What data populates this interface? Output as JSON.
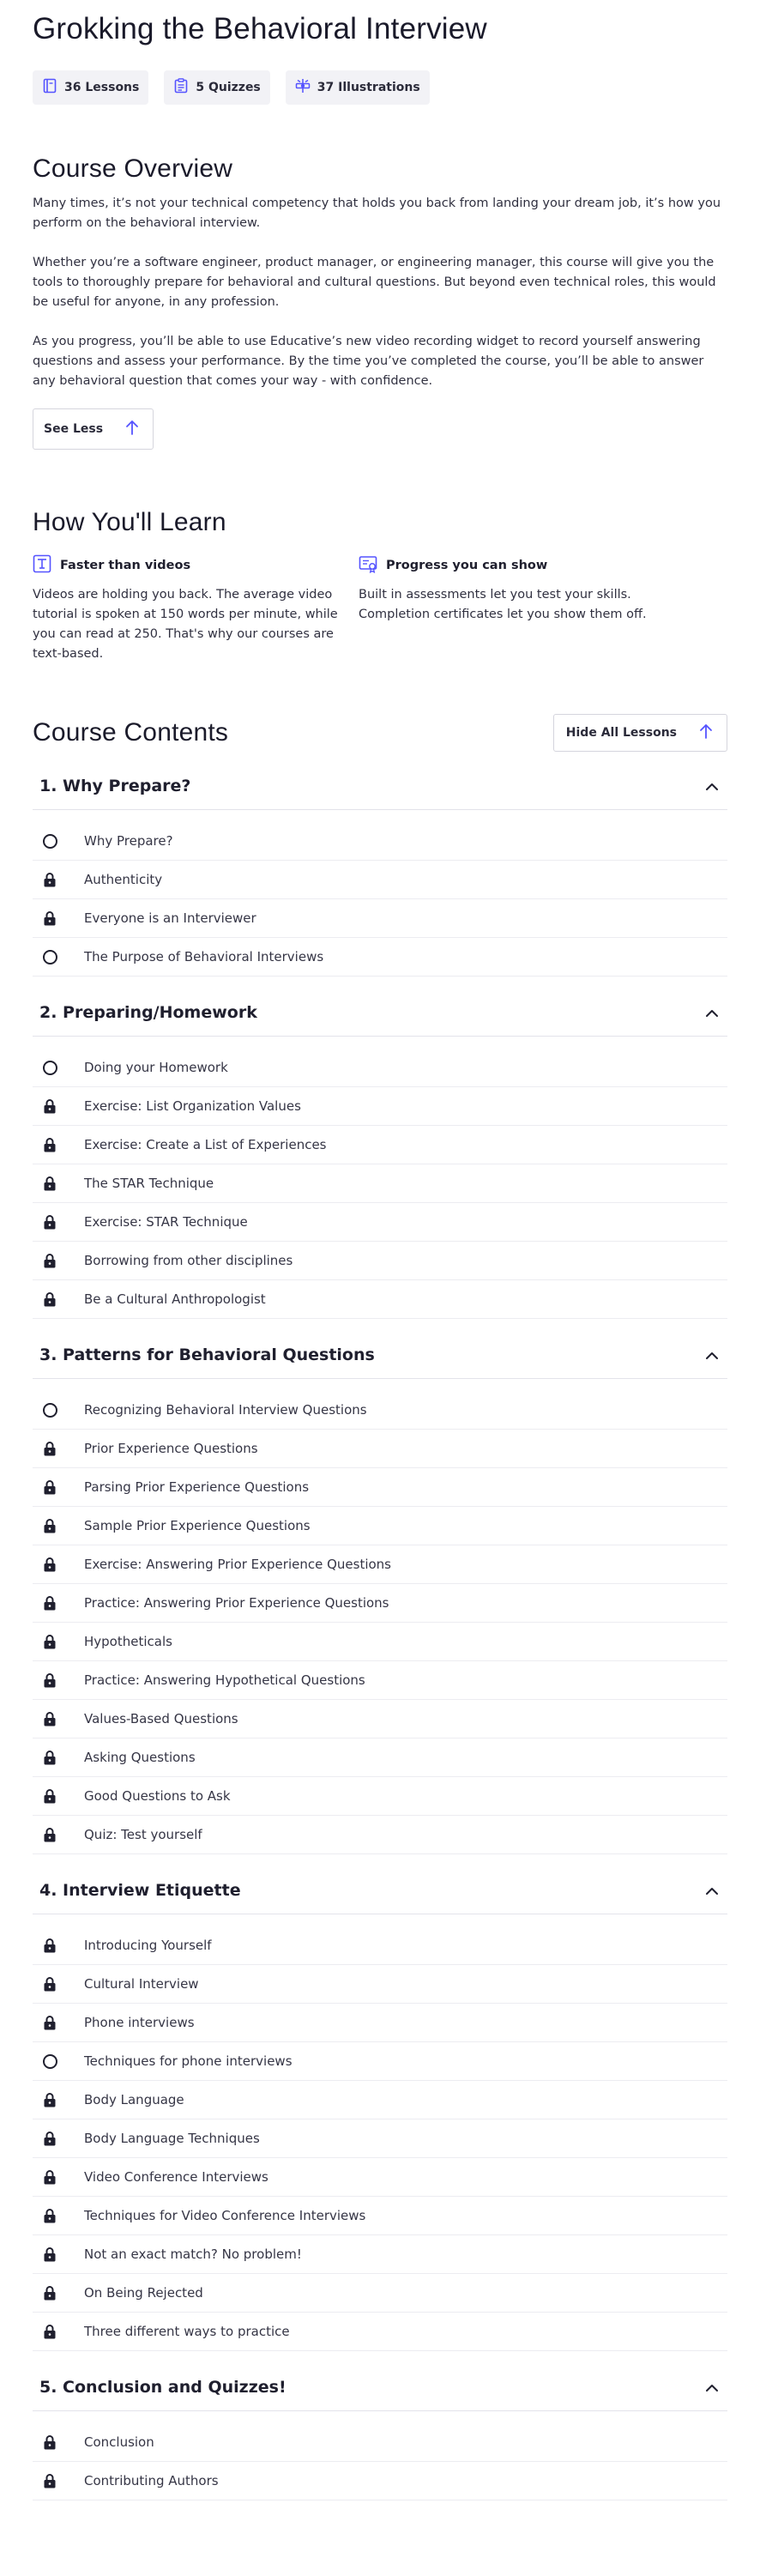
{
  "course": {
    "title": "Grokking the Behavioral Interview",
    "stats": [
      {
        "label": "36 Lessons",
        "icon": "lessons-icon"
      },
      {
        "label": "5 Quizzes",
        "icon": "quiz-icon"
      },
      {
        "label": "37 Illustrations",
        "icon": "illustrations-icon"
      }
    ]
  },
  "overview": {
    "heading": "Course Overview",
    "paragraphs": [
      "Many times, it’s not your technical competency that holds you back from landing your dream job, it’s how you perform on the behavioral interview.",
      "Whether you’re a software engineer, product manager, or engineering manager, this course will give you the tools to thoroughly prepare for behavioral and cultural questions. But beyond even technical roles, this would be useful for anyone, in any profession.",
      "As you progress, you’ll be able to use Educative’s new video recording widget to record yourself answering questions and assess your performance. By the time you’ve completed the course, you’ll be able to answer any behavioral question that comes your way - with confidence."
    ],
    "see_less": "See Less"
  },
  "learn": {
    "heading": "How You'll Learn",
    "items": [
      {
        "title": "Faster than videos",
        "text": "Videos are holding you back. The average video tutorial is spoken at 150 words per minute, while you can read at 250. That's why our courses are text-based."
      },
      {
        "title": "Progress you can show",
        "text": "Built in assessments let you test your skills. Completion certificates let you show them off."
      }
    ]
  },
  "contents": {
    "heading": "Course Contents",
    "hide_all": "Hide All Lessons",
    "sections": [
      {
        "title": "1. Why Prepare?",
        "lessons": [
          {
            "name": "Why Prepare?",
            "status": "open"
          },
          {
            "name": "Authenticity",
            "status": "locked"
          },
          {
            "name": "Everyone is an Interviewer",
            "status": "locked"
          },
          {
            "name": "The Purpose of Behavioral Interviews",
            "status": "open"
          }
        ]
      },
      {
        "title": "2. Preparing/Homework",
        "lessons": [
          {
            "name": "Doing your Homework",
            "status": "open"
          },
          {
            "name": "Exercise: List Organization Values",
            "status": "locked"
          },
          {
            "name": "Exercise: Create a List of Experiences",
            "status": "locked"
          },
          {
            "name": "The STAR Technique",
            "status": "locked"
          },
          {
            "name": "Exercise: STAR Technique",
            "status": "locked"
          },
          {
            "name": "Borrowing from other disciplines",
            "status": "locked"
          },
          {
            "name": "Be a Cultural Anthropologist",
            "status": "locked"
          }
        ]
      },
      {
        "title": "3. Patterns for Behavioral Questions",
        "lessons": [
          {
            "name": "Recognizing Behavioral Interview Questions",
            "status": "open"
          },
          {
            "name": "Prior Experience Questions",
            "status": "locked"
          },
          {
            "name": "Parsing Prior Experience Questions",
            "status": "locked"
          },
          {
            "name": "Sample Prior Experience Questions",
            "status": "locked"
          },
          {
            "name": "Exercise: Answering Prior Experience Questions",
            "status": "locked"
          },
          {
            "name": "Practice: Answering Prior Experience Questions",
            "status": "locked"
          },
          {
            "name": "Hypotheticals",
            "status": "locked"
          },
          {
            "name": "Practice: Answering Hypothetical Questions",
            "status": "locked"
          },
          {
            "name": "Values-Based Questions",
            "status": "locked"
          },
          {
            "name": "Asking Questions",
            "status": "locked"
          },
          {
            "name": "Good Questions to Ask",
            "status": "locked"
          },
          {
            "name": "Quiz: Test yourself",
            "status": "locked"
          }
        ]
      },
      {
        "title": "4. Interview Etiquette",
        "lessons": [
          {
            "name": "Introducing Yourself",
            "status": "locked"
          },
          {
            "name": "Cultural Interview",
            "status": "locked"
          },
          {
            "name": "Phone interviews",
            "status": "locked"
          },
          {
            "name": "Techniques for phone interviews",
            "status": "open"
          },
          {
            "name": "Body Language",
            "status": "locked"
          },
          {
            "name": "Body Language Techniques",
            "status": "locked"
          },
          {
            "name": "Video Conference Interviews",
            "status": "locked"
          },
          {
            "name": "Techniques for Video Conference Interviews",
            "status": "locked"
          },
          {
            "name": "Not an exact match? No problem!",
            "status": "locked"
          },
          {
            "name": "On Being Rejected",
            "status": "locked"
          },
          {
            "name": "Three different ways to practice",
            "status": "locked"
          }
        ]
      },
      {
        "title": "5. Conclusion and Quizzes!",
        "lessons": [
          {
            "name": "Conclusion",
            "status": "locked"
          },
          {
            "name": "Contributing Authors",
            "status": "locked"
          }
        ]
      }
    ]
  },
  "colors": {
    "accent": "#5553ff",
    "text": "#1f1f2e",
    "chip_bg": "#f2f2f6"
  }
}
